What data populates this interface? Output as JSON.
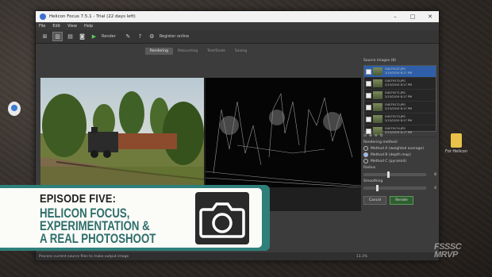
{
  "window": {
    "title": "Helicon Focus 7.5.1 - Trial (22 days left)",
    "menu": [
      "File",
      "Edit",
      "View",
      "Help"
    ],
    "toolbar": {
      "render_label": "Render",
      "register_label": "Register online"
    },
    "tabs": [
      "Rendering",
      "Retouching",
      "Text/Scale",
      "Saving"
    ],
    "active_tab": "Rendering"
  },
  "source_panel": {
    "header": "Source images (8)",
    "images": [
      {
        "name": "G4079137.JPG",
        "date": "2/15/2019 8:17 PM",
        "selected": true
      },
      {
        "name": "G4079170.JPG",
        "date": "2/15/2019 8:17 PM",
        "selected": false
      },
      {
        "name": "G4079171.JPG",
        "date": "2/15/2019 8:17 PM",
        "selected": false
      },
      {
        "name": "G4079172.JPG",
        "date": "2/15/2019 8:17 PM",
        "selected": false
      },
      {
        "name": "G4079173.JPG",
        "date": "2/15/2019 8:17 PM",
        "selected": false
      },
      {
        "name": "G4079174.JPG",
        "date": "2/15/2019 8:17 PM",
        "selected": false
      }
    ]
  },
  "render_panel": {
    "method_label": "Rendering method:",
    "methods": [
      "Method A (weighted average)",
      "Method B (depth map)",
      "Method C (pyramid)"
    ],
    "selected_method": 1,
    "radius_label": "Radius",
    "radius_value": "8",
    "smoothing_label": "Smoothing",
    "smoothing_value": "4",
    "cancel_label": "Cancel",
    "render_label": "Render"
  },
  "status": {
    "message": "Process current source files to make output image",
    "zoom": "13.3%"
  },
  "desktop": {
    "icon_right_label": "For Helicon"
  },
  "banner": {
    "episode": "EPISODE FIVE:",
    "line1": "HELICON FOCUS,",
    "line2": "EXPERIMENTATION &",
    "line3": "A REAL PHOTOSHOOT"
  },
  "watermark": {
    "line1": "FSSSC",
    "line2": "MRVP"
  },
  "colors": {
    "banner_teal": "#2f7f7a",
    "selection_blue": "#2e5fa8"
  }
}
